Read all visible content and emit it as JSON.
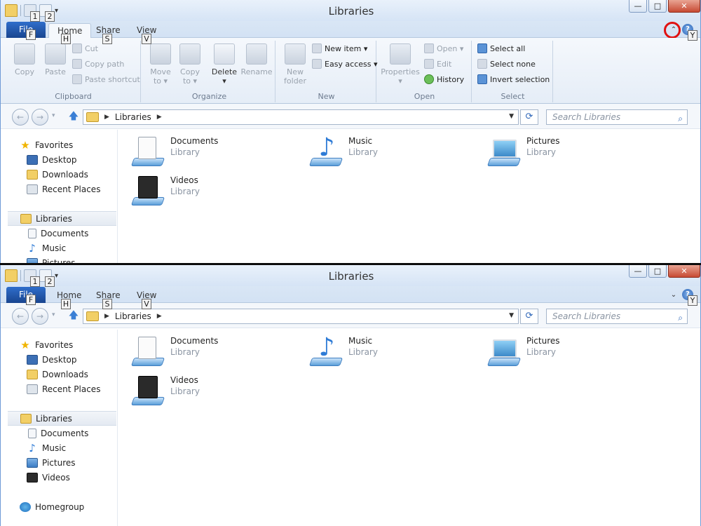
{
  "window": {
    "title": "Libraries",
    "minimize_label": "—",
    "maximize_label": "□",
    "close_label": "✕"
  },
  "qat": {
    "keytips": [
      "1",
      "2"
    ],
    "dropdown_glyph": "▾"
  },
  "tabs": {
    "file": "File",
    "home": "Home",
    "share": "Share",
    "view": "View"
  },
  "keytips": {
    "file": "F",
    "home": "H",
    "share": "S",
    "view": "V",
    "help": "Y"
  },
  "ribbon": {
    "toggle_expanded": "⌃",
    "toggle_collapsed": "⌄",
    "help": "?",
    "groups": {
      "clipboard": {
        "label": "Clipboard",
        "copy": "Copy",
        "paste": "Paste",
        "cut": "Cut",
        "copy_path": "Copy path",
        "paste_shortcut": "Paste shortcut"
      },
      "organize": {
        "label": "Organize",
        "move_to_1": "Move",
        "move_to_2": "to ▾",
        "copy_to_1": "Copy",
        "copy_to_2": "to ▾",
        "delete_1": "Delete",
        "delete_2": "▾",
        "rename": "Rename"
      },
      "new": {
        "label": "New",
        "new_folder_1": "New",
        "new_folder_2": "folder",
        "new_item": "New item ▾",
        "easy_access": "Easy access ▾"
      },
      "open": {
        "label": "Open",
        "properties_1": "Properties",
        "properties_2": "▾",
        "open": "Open ▾",
        "edit": "Edit",
        "history": "History"
      },
      "select": {
        "label": "Select",
        "select_all": "Select all",
        "select_none": "Select none",
        "invert_selection": "Invert selection"
      }
    }
  },
  "address": {
    "back": "←",
    "forward": "→",
    "recent": "▾",
    "up": "🡅",
    "arrow": "▶",
    "path": "Libraries",
    "dropdown": "▼",
    "refresh": "⟳",
    "search_placeholder": "Search Libraries",
    "search_icon": "⌕"
  },
  "nav": {
    "favorites": "Favorites",
    "desktop": "Desktop",
    "downloads": "Downloads",
    "recent_places": "Recent Places",
    "libraries": "Libraries",
    "documents": "Documents",
    "music": "Music",
    "pictures": "Pictures",
    "videos": "Videos",
    "homegroup": "Homegroup",
    "star": "★",
    "note": "♪"
  },
  "libraries": [
    {
      "name": "Documents",
      "type": "Library"
    },
    {
      "name": "Music",
      "type": "Library"
    },
    {
      "name": "Pictures",
      "type": "Library"
    },
    {
      "name": "Videos",
      "type": "Library"
    }
  ],
  "colors": {
    "file_tab": "#2f6ecb",
    "close_button": "#c74a33",
    "highlight_circle": "#e01010"
  }
}
